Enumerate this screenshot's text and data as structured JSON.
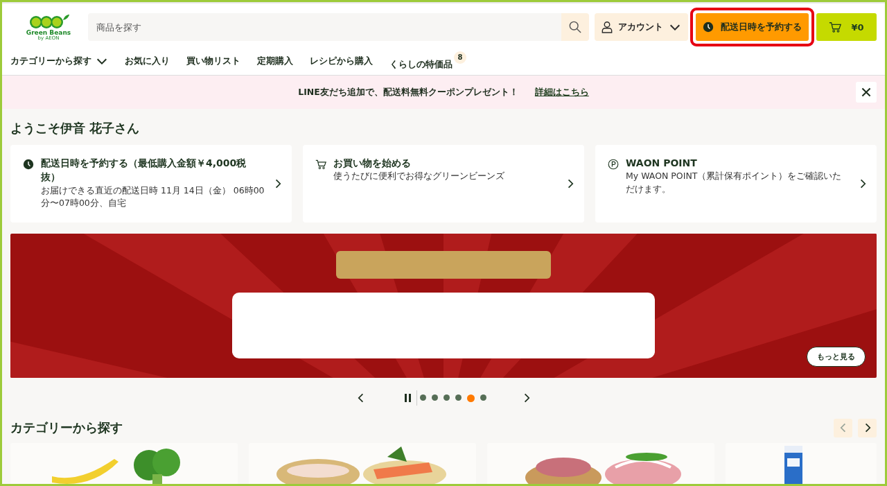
{
  "header": {
    "logo": {
      "text": "Green Beans",
      "subtext": "by AEON"
    },
    "search": {
      "placeholder": "商品を探す"
    },
    "account": {
      "label": "アカウント"
    },
    "reserve": {
      "label": "配送日時を予約する",
      "highlighted": true
    },
    "cart": {
      "total": "¥0"
    }
  },
  "nav": [
    {
      "label": "カテゴリーから探す",
      "dropdown": true
    },
    {
      "label": "お気に入り",
      "dropdown": false
    },
    {
      "label": "買い物リスト",
      "dropdown": false
    },
    {
      "label": "定期購入",
      "dropdown": false
    },
    {
      "label": "レシピから購入",
      "dropdown": false
    },
    {
      "label": "くらしの特価品",
      "dropdown": false,
      "badge": "8"
    }
  ],
  "notice": {
    "text": "LINE友だち追加で、配送料無料クーポンプレゼント！",
    "link": "詳細はこちら"
  },
  "welcome": "ようこそ伊音 花子さん",
  "cards": [
    {
      "kind": "clock",
      "title": "配送日時を予約する（最低購入金額￥4,000税抜）",
      "body": "お届けできる直近の配送日時 11月 14日（金） 06時00分〜07時00分、自宅"
    },
    {
      "kind": "cart",
      "title": "お買い物を始める",
      "body": "使うたびに便利でお得なグリーンビーンズ"
    },
    {
      "kind": "point",
      "title": "WAON POINT",
      "body": "My WAON POINT（累計保有ポイント）をご確認いただけます。"
    }
  ],
  "hero": {
    "kind": "picture",
    "more": "もっと見る"
  },
  "carousel": {
    "dots": [
      {
        "selected": false
      },
      {
        "selected": false
      },
      {
        "selected": false
      },
      {
        "selected": false
      },
      {
        "selected": true
      },
      {
        "selected": false
      }
    ]
  },
  "category_section": {
    "title": "カテゴリーから探す",
    "prev_disabled": true
  }
}
